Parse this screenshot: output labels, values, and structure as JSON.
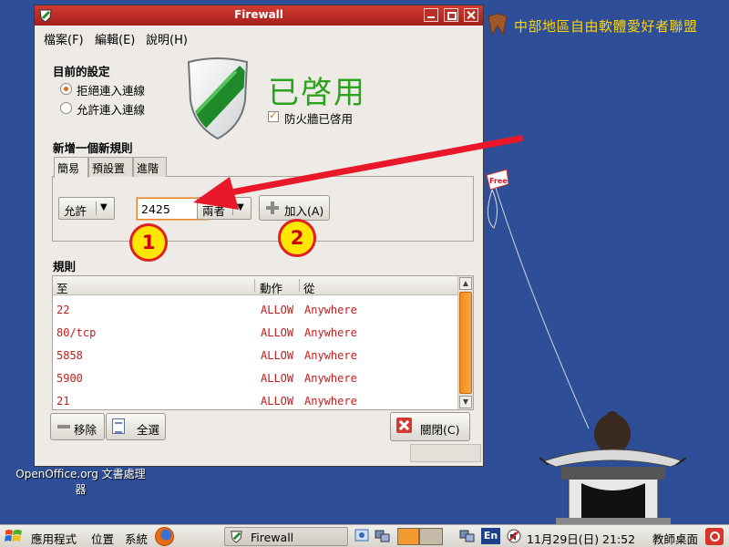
{
  "desktop": {
    "brand_text": "中部地區自由軟體愛好者聯盟",
    "kite_text": "Free",
    "icon_label": "OpenOffice.org 文書處理器"
  },
  "window": {
    "title": "Firewall",
    "menu": [
      {
        "label": "檔案(F)"
      },
      {
        "label": "編輯(E)"
      },
      {
        "label": "說明(H)"
      }
    ],
    "current_settings": {
      "title": "目前的設定",
      "options": [
        {
          "label": "拒絕連入連線",
          "selected": true
        },
        {
          "label": "允許連入連線",
          "selected": false
        }
      ]
    },
    "status": {
      "text": "已啓用",
      "checkbox_label": "防火牆已啓用",
      "checked": true,
      "color": "#2ca31e"
    },
    "new_rule": {
      "title": "新增一個新規則",
      "tabs": [
        {
          "label": "簡易",
          "active": true
        },
        {
          "label": "預設置",
          "active": false
        },
        {
          "label": "進階",
          "active": false
        }
      ],
      "action_value": "允許",
      "port_value": "2425",
      "protocol_value": "兩者",
      "add_button": "加入(A)"
    },
    "rules": {
      "title": "規則",
      "columns": [
        "至",
        "動作",
        "從"
      ],
      "rows": [
        {
          "to": "22",
          "action": "ALLOW",
          "from": "Anywhere"
        },
        {
          "to": "80/tcp",
          "action": "ALLOW",
          "from": "Anywhere"
        },
        {
          "to": "5858",
          "action": "ALLOW",
          "from": "Anywhere"
        },
        {
          "to": "5900",
          "action": "ALLOW",
          "from": "Anywhere"
        },
        {
          "to": "21",
          "action": "ALLOW",
          "from": "Anywhere"
        }
      ],
      "row_color": "#c31c1c"
    },
    "buttons": {
      "remove": "移除",
      "select_all": "全選",
      "close": "關閉(C)"
    }
  },
  "annotations": {
    "step1": "1",
    "step2": "2",
    "arrow_color": "#e8182a"
  },
  "taskbar": {
    "apps_menu": "應用程式",
    "places_menu": "位置",
    "system_menu": "系統",
    "task_label": "Firewall",
    "input_method": "En",
    "clock": "11月29日(日) 21:52",
    "desktop_label": "教師桌面"
  }
}
